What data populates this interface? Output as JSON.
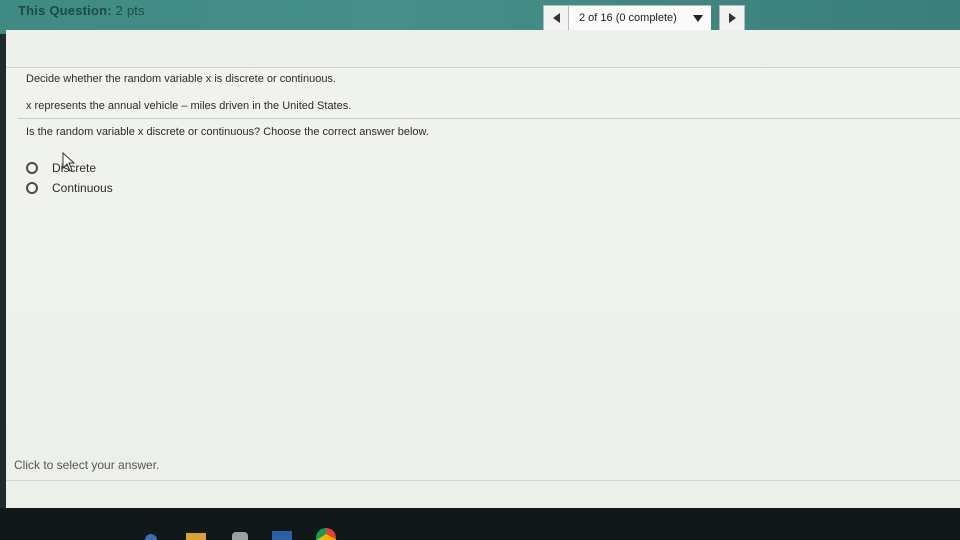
{
  "header": {
    "question_label": "This Question:",
    "points": "2 pts",
    "progress": "2 of 16 (0 complete)"
  },
  "content": {
    "prompt": "Decide whether the random variable x is discrete or continuous.",
    "context": "x represents the annual vehicle – miles driven in the United States.",
    "question": "Is the random variable x discrete or continuous? Choose the correct answer below.",
    "options": [
      {
        "label": "Discrete"
      },
      {
        "label": "Continuous"
      }
    ],
    "footer_hint": "Click to select your answer."
  },
  "taskbar": {
    "icons": [
      "file-explorer-icon",
      "folder-icon",
      "store-icon",
      "word-icon",
      "chrome-icon"
    ]
  },
  "colors": {
    "header_bar": "#468f89",
    "panel_background": "#eef1ec"
  }
}
